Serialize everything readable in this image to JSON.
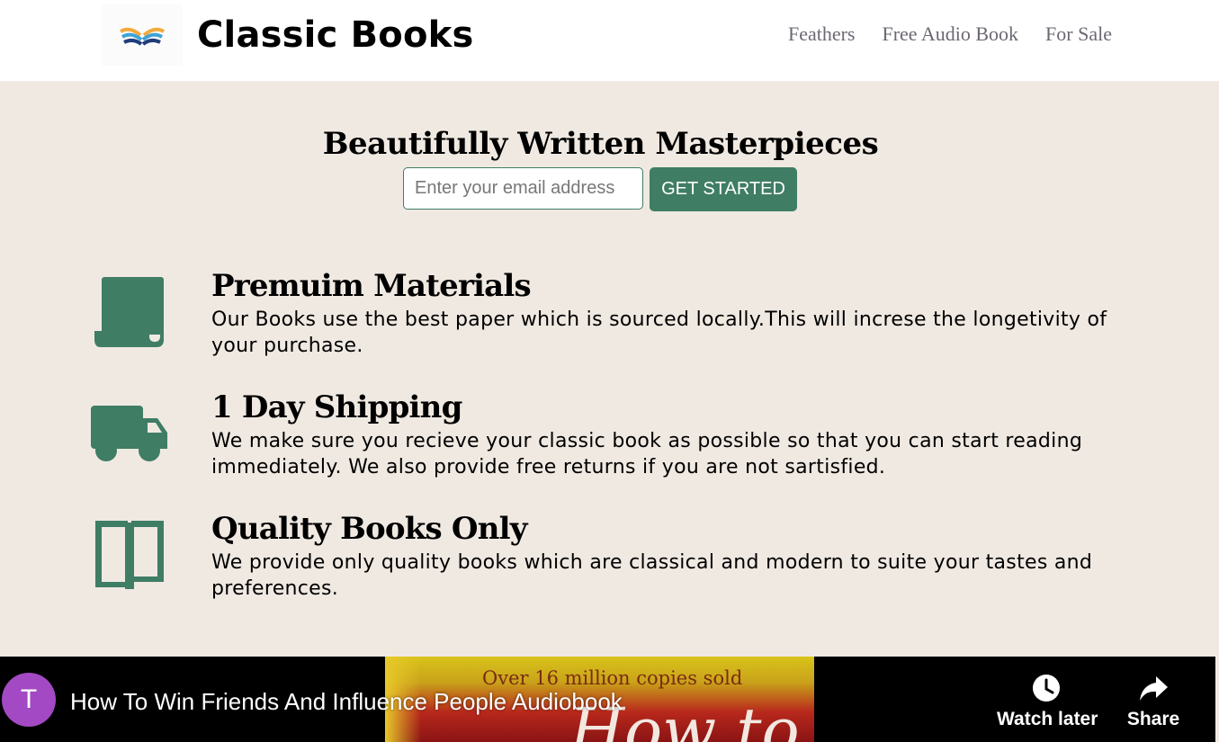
{
  "header": {
    "brand": "Classic Books",
    "nav": [
      "Feathers",
      "Free Audio Book",
      "For Sale"
    ]
  },
  "hero": {
    "title": "Beautifully Written Masterpieces",
    "email_placeholder": "Enter your email address",
    "cta_label": "GET STARTED"
  },
  "features": [
    {
      "icon": "scroll-icon",
      "title": "Premuim Materials",
      "text": "Our Books use the best paper which is sourced locally.This will increse the longetivity of your purchase."
    },
    {
      "icon": "truck-icon",
      "title": "1 Day Shipping",
      "text": "We make sure you recieve your classic book as possible so that you can start reading immediately. We also provide free returns if you are not sartisfied."
    },
    {
      "icon": "open-book-icon",
      "title": "Quality Books Only",
      "text": "We provide only quality books which are classical and modern to suite your tastes and preferences."
    }
  ],
  "video": {
    "channel_initial": "T",
    "title": "How To Win Friends And Influence People Audiobook",
    "thumbnail_top_text": "Over 16 million copies sold",
    "thumbnail_big_text": "How to",
    "watch_later_label": "Watch later",
    "share_label": "Share"
  },
  "colors": {
    "accent": "#3f7d65",
    "page_background": "#f0e9e2",
    "nav_text": "#6d6773",
    "avatar": "#a349c4"
  }
}
